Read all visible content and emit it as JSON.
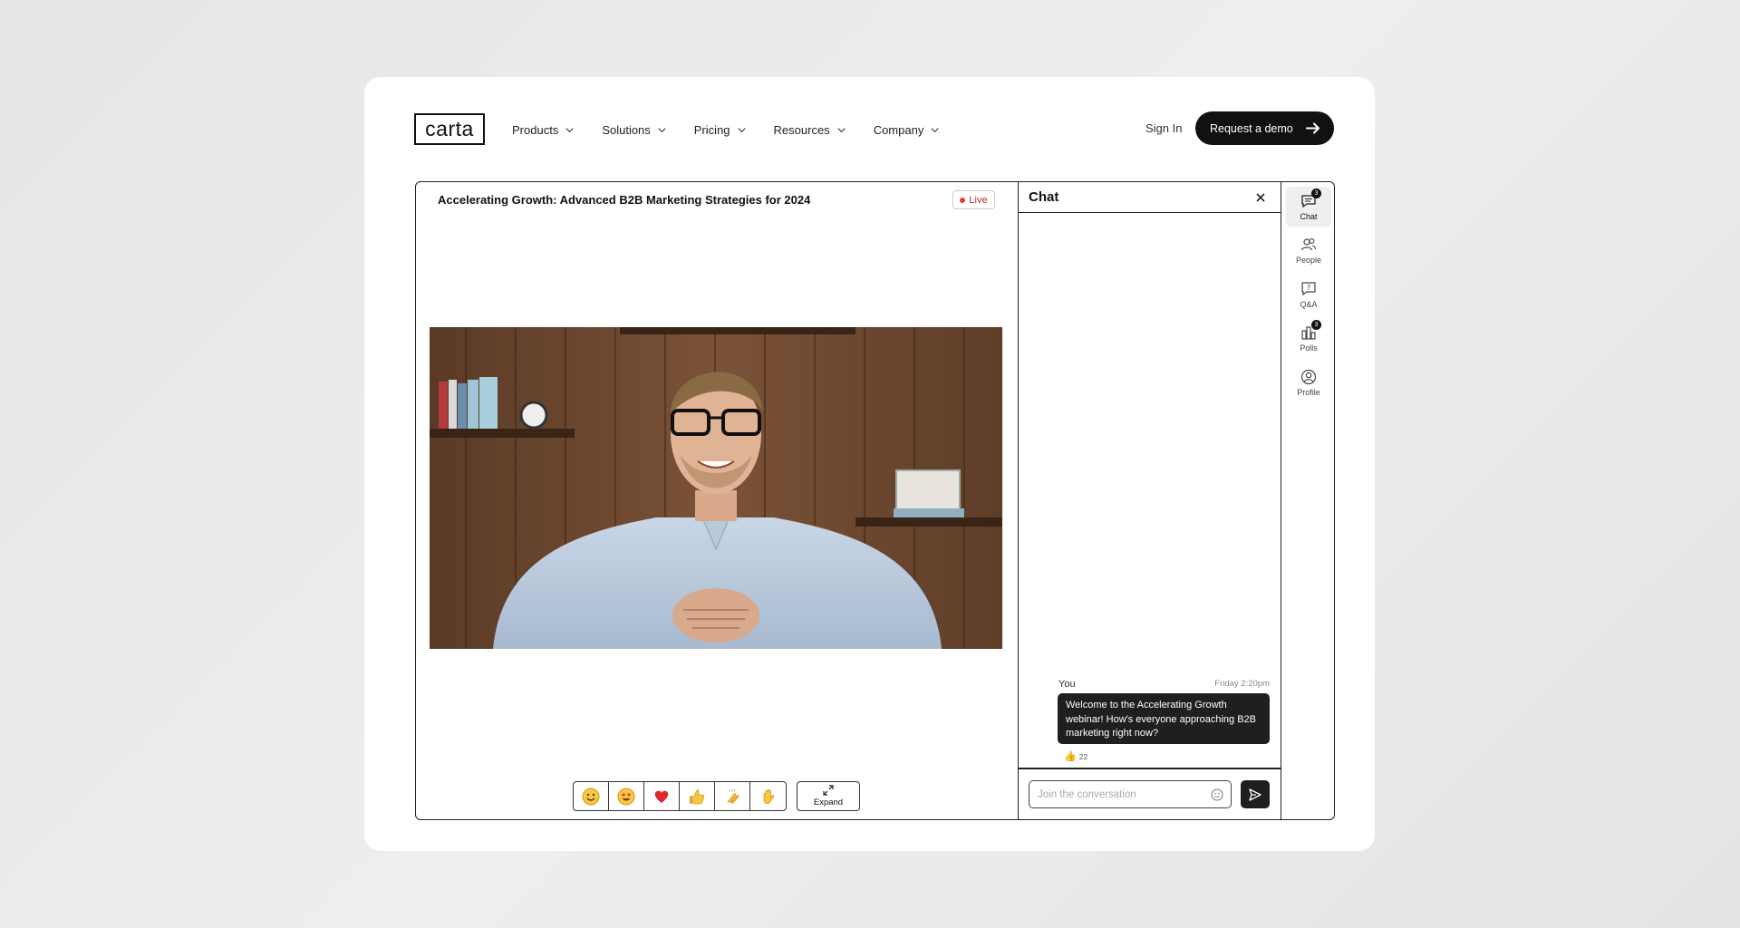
{
  "brand": {
    "logo_text": "carta"
  },
  "nav": {
    "items": [
      {
        "label": "Products"
      },
      {
        "label": "Solutions"
      },
      {
        "label": "Pricing"
      },
      {
        "label": "Resources"
      },
      {
        "label": "Company"
      }
    ],
    "sign_in": "Sign In",
    "cta": "Request a demo"
  },
  "webinar": {
    "title": "Accelerating Growth: Advanced B2B Marketing Strategies for 2024",
    "live_label": "Live",
    "reactions": [
      "😊",
      "🤩",
      "❤️",
      "👍",
      "👏",
      "👋"
    ],
    "expand_label": "Expand"
  },
  "chat": {
    "header": "Chat",
    "message": {
      "author": "You",
      "time": "Friday 2:20pm",
      "text": "Welcome to the Accelerating Growth webinar! How's everyone approaching B2B marketing right now?",
      "reaction_emoji": "👍",
      "reaction_count": "22"
    },
    "input_placeholder": "Join the conversation"
  },
  "rail": {
    "items": [
      {
        "label": "Chat",
        "icon": "chat-icon",
        "badge": "3",
        "active": true
      },
      {
        "label": "People",
        "icon": "people-icon"
      },
      {
        "label": "Q&A",
        "icon": "qa-icon"
      },
      {
        "label": "Polls",
        "icon": "polls-icon",
        "badge": "3"
      },
      {
        "label": "Profile",
        "icon": "profile-icon"
      }
    ]
  },
  "colors": {
    "accent": "#111111",
    "live": "#e53935",
    "bubble": "#1f1f1f"
  }
}
